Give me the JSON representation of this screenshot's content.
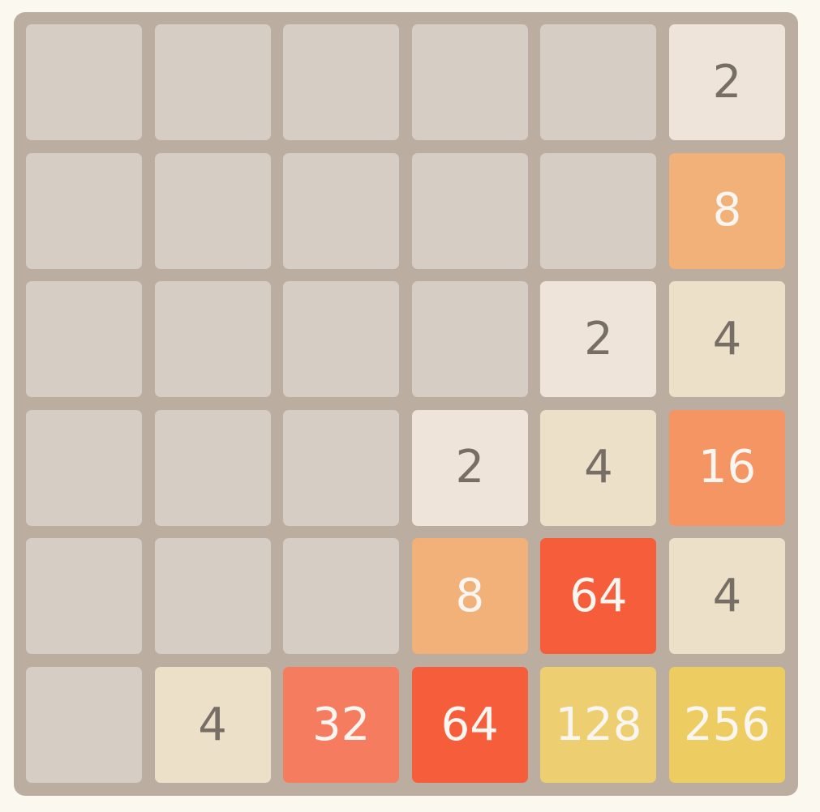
{
  "board": {
    "rows": 6,
    "cols": 6,
    "cells": [
      [
        null,
        null,
        null,
        null,
        null,
        2
      ],
      [
        null,
        null,
        null,
        null,
        null,
        8
      ],
      [
        null,
        null,
        null,
        null,
        2,
        4
      ],
      [
        null,
        null,
        null,
        2,
        4,
        16
      ],
      [
        null,
        null,
        null,
        8,
        64,
        4
      ],
      [
        null,
        4,
        32,
        64,
        128,
        256
      ]
    ]
  },
  "colors": {
    "board_background": "#bbada0",
    "empty_cell": "#d6cdc4",
    "page_background": "#faf8ef",
    "tile_2": "#eee4da",
    "tile_4": "#ede0c8",
    "tile_8": "#f2b179",
    "tile_16": "#f59563",
    "tile_32": "#f67c5f",
    "tile_64": "#f65e3b",
    "tile_128": "#edcf72",
    "tile_256": "#edcc61",
    "dark_text": "#776e65",
    "light_text": "#f9f6f2"
  }
}
